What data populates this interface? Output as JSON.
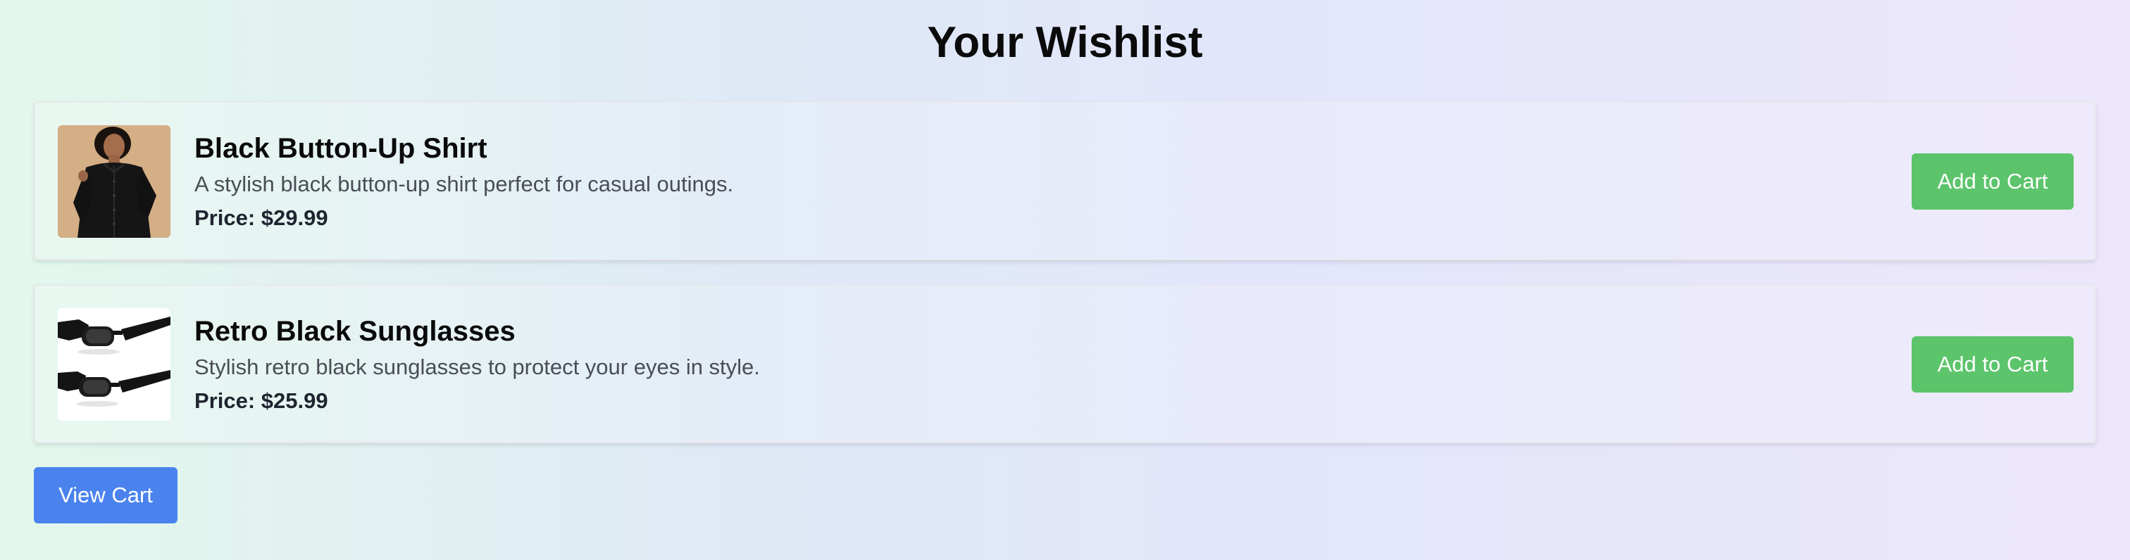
{
  "page": {
    "title": "Your Wishlist"
  },
  "wishlist": {
    "items": [
      {
        "image_icon": "shirt-photo-icon",
        "name": "Black Button-Up Shirt",
        "description": "A stylish black button-up shirt perfect for casual outings.",
        "price": "Price: $29.99",
        "add_to_cart_label": "Add to Cart"
      },
      {
        "image_icon": "sunglasses-photo-icon",
        "name": "Retro Black Sunglasses",
        "description": "Stylish retro black sunglasses to protect your eyes in style.",
        "price": "Price: $25.99",
        "add_to_cart_label": "Add to Cart"
      }
    ]
  },
  "footer": {
    "view_cart_label": "View Cart"
  },
  "colors": {
    "add_to_cart_button": "#5cc46b",
    "view_cart_button": "#4a83ee",
    "background_start": "#e3f8ec",
    "background_end": "#ece6fb"
  }
}
